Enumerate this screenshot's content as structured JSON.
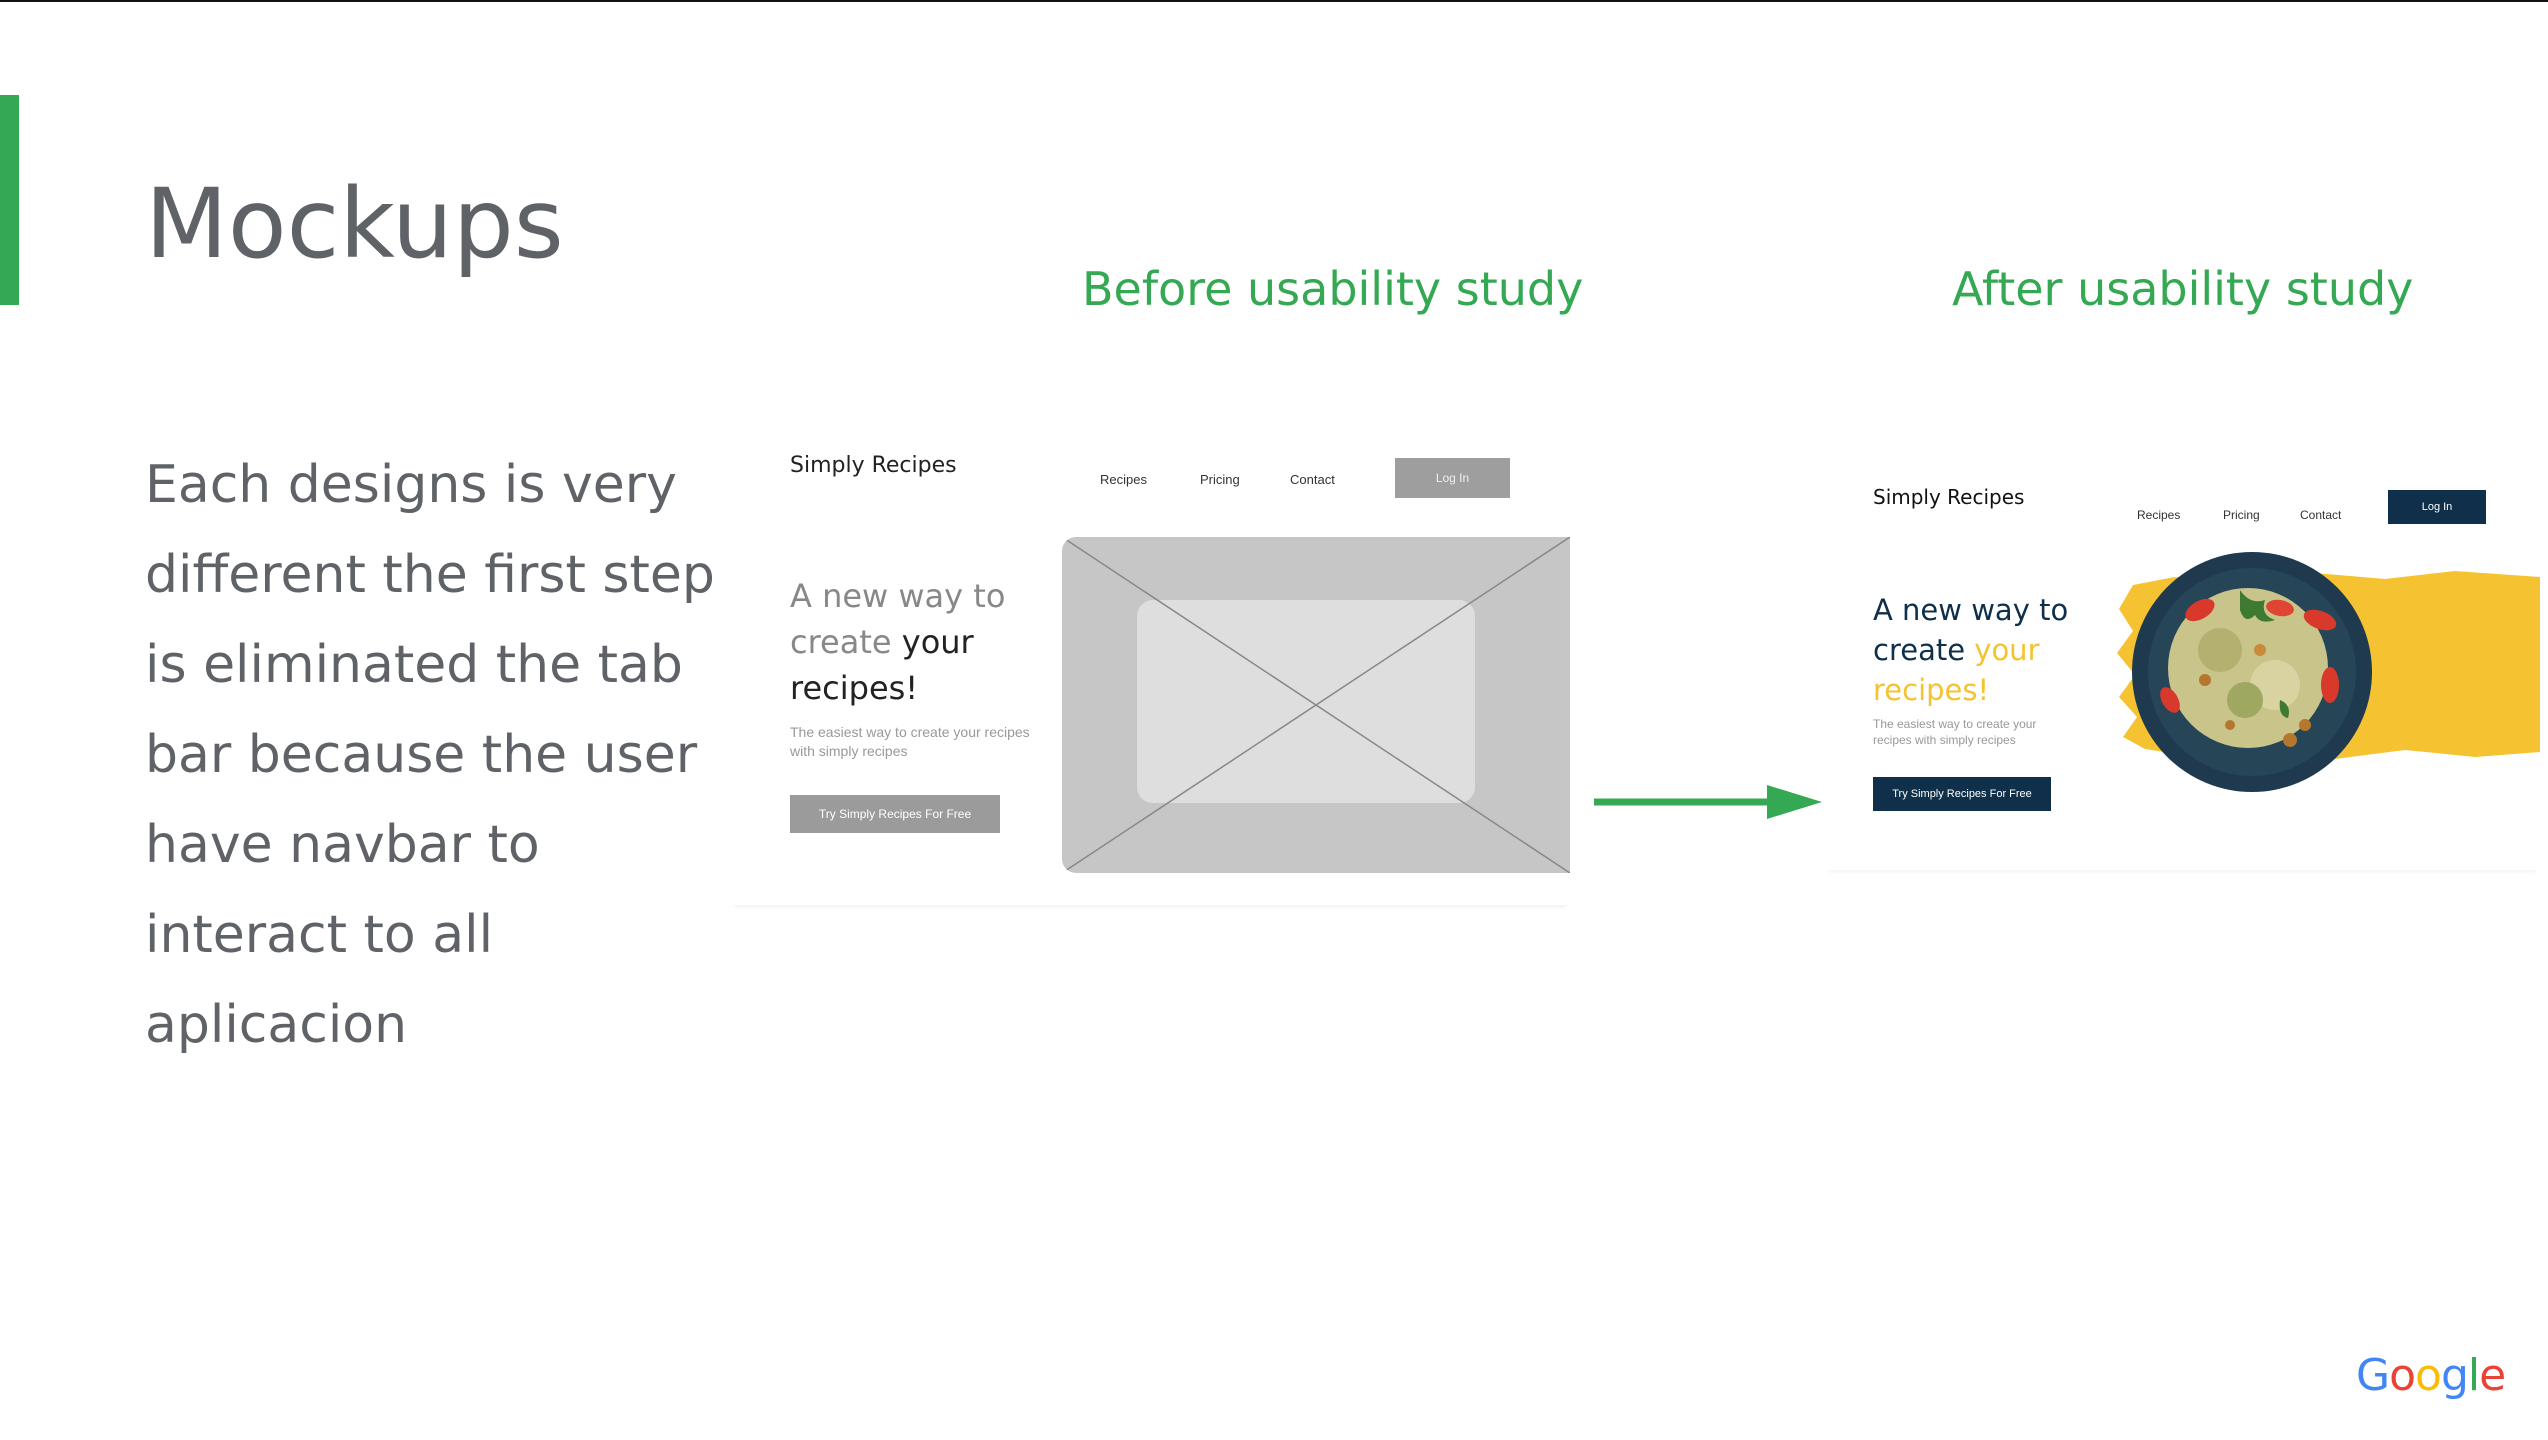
{
  "slide": {
    "title": "Mockups",
    "caption_before": "Before usability study",
    "caption_after": "After usability study",
    "body_text": "Each designs is very different the first step is eliminated the tab bar because the user have navbar to interact to all aplicacion",
    "accent_color": "#34a853",
    "text_color": "#5f6368"
  },
  "mockup_before": {
    "brand": "Simply Recipes",
    "nav": [
      "Recipes",
      "Pricing",
      "Contact"
    ],
    "login": "Log In",
    "hero_line_plain": "A new way to create ",
    "hero_line_em": "your recipes!",
    "subtitle": "The easiest way to create your recipes with simply recipes",
    "cta": "Try Simply Recipes For Free",
    "image_placeholder_icon": "image-placeholder-icon"
  },
  "mockup_after": {
    "brand": "Simply Recipes",
    "nav": [
      "Recipes",
      "Pricing",
      "Contact"
    ],
    "login": "Log In",
    "hero_line_plain": "A new way to create ",
    "hero_line_em": "your recipes!",
    "subtitle": "The easiest way to create your recipes with simply recipes",
    "cta": "Try Simply Recipes For Free",
    "primary_color": "#0f2f4a",
    "highlight_color": "#f5c331",
    "image_icon": "salad-plate-icon"
  },
  "footer": {
    "logo_letters": [
      "G",
      "o",
      "o",
      "g",
      "l",
      "e"
    ],
    "logo_colors": [
      "#4285f4",
      "#ea4335",
      "#fbbc05",
      "#4285f4",
      "#34a853",
      "#ea4335"
    ]
  }
}
